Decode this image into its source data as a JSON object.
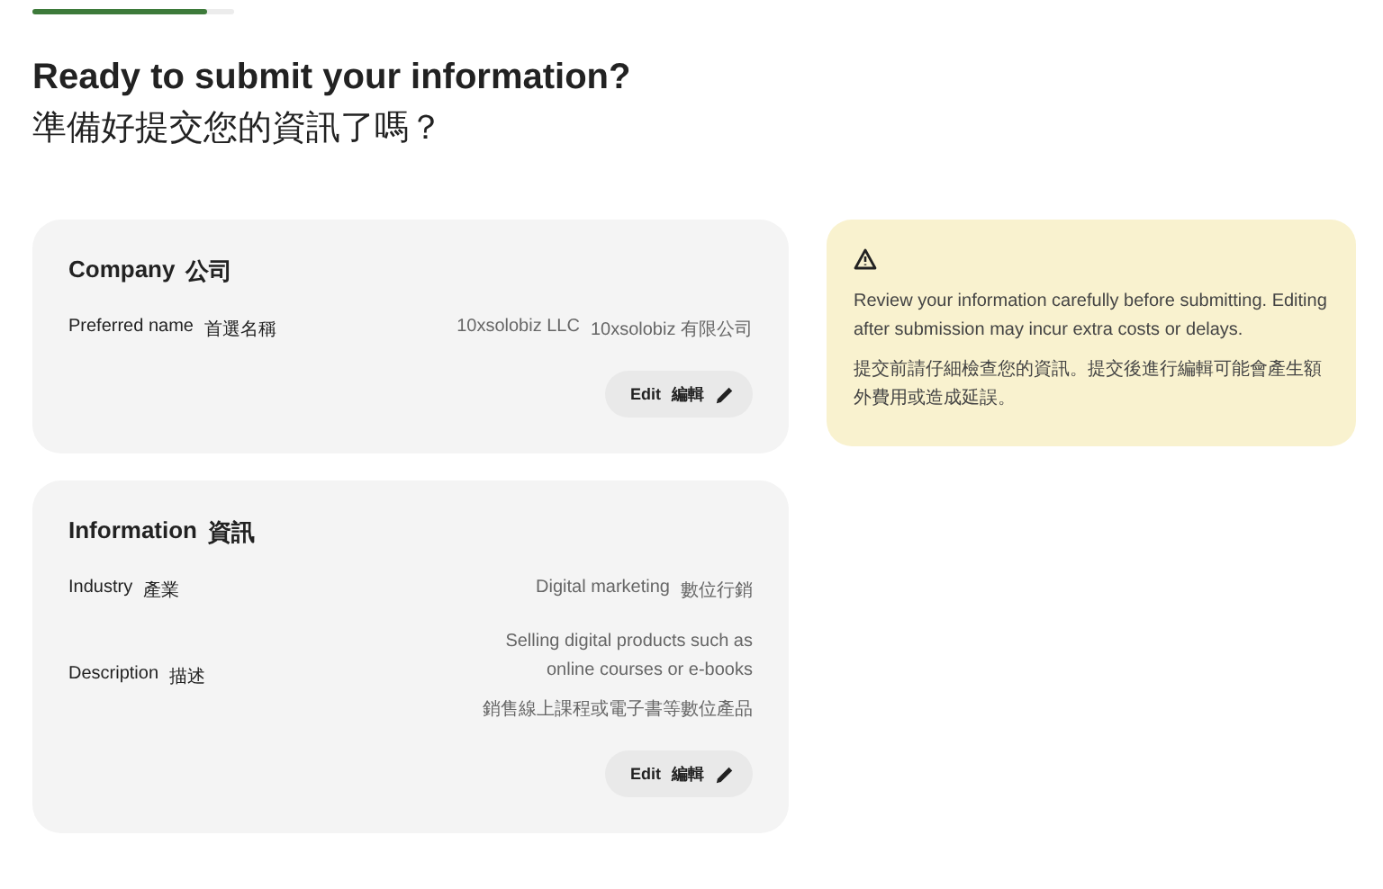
{
  "progress": {
    "level": 0.87
  },
  "heading": {
    "title": "Ready to submit your information?",
    "subtitle": "準備好提交您的資訊了嗎？"
  },
  "sections": [
    {
      "title": "Company",
      "title_zh": "公司",
      "rows": [
        {
          "label": "Preferred name",
          "label_zh": "首選名稱",
          "values": [
            "10xsolobiz LLC",
            "10xsolobiz 有限公司"
          ],
          "kind": "inline"
        }
      ],
      "edit": {
        "label": "Edit",
        "label_zh": "編輯"
      }
    },
    {
      "title": "Information",
      "title_zh": "資訊",
      "rows": [
        {
          "label": "Industry",
          "label_zh": "產業",
          "values": [
            "Digital marketing",
            "數位行銷"
          ],
          "kind": "inline"
        },
        {
          "label": "Description",
          "label_zh": "描述",
          "values": [
            "Selling digital products such as online courses or e-books",
            "銷售線上課程或電子書等數位產品"
          ],
          "kind": "stacked"
        }
      ],
      "edit": {
        "label": "Edit",
        "label_zh": "編輯"
      }
    }
  ],
  "notice": {
    "text": "Review your information carefully before submitting. Editing after submission may incur extra costs or delays.",
    "text_zh": "提交前請仔細檢查您的資訊。提交後進行編輯可能會產生額外費用或造成延誤。"
  }
}
